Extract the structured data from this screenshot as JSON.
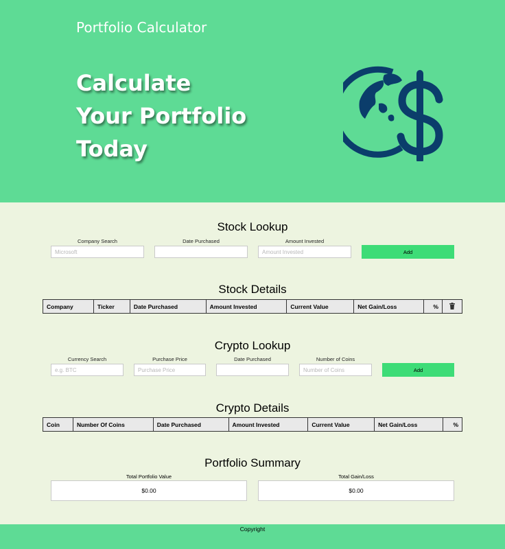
{
  "header": {
    "brand": "Portfolio Calculator",
    "headline": [
      "Calculate",
      "Your Portfolio",
      "Today"
    ],
    "logo_icon": "globe-dollar-icon",
    "logo_color": "#0b3d6b"
  },
  "stock_lookup": {
    "title": "Stock Lookup",
    "company_label": "Company Search",
    "company_placeholder": "Microsoft",
    "date_label": "Date Purchased",
    "amount_label": "Amount Invested",
    "amount_placeholder": "Amount Invested",
    "add_label": "Add"
  },
  "stock_details": {
    "title": "Stock Details",
    "columns": [
      "Company",
      "Ticker",
      "Date Purchased",
      "Amount Invested",
      "Current Value",
      "Net Gain/Loss",
      "%"
    ],
    "trash_icon": "trash-icon"
  },
  "crypto_lookup": {
    "title": "Crypto Lookup",
    "currency_label": "Currency Search",
    "currency_placeholder": "e.g. BTC",
    "price_label": "Purchase Price",
    "price_placeholder": "Purchase Price",
    "date_label": "Date Purchased",
    "coins_label": "Number of Coins",
    "coins_placeholder": "Number of Coins",
    "add_label": "Add"
  },
  "crypto_details": {
    "title": "Crypto Details",
    "columns": [
      "Coin",
      "Number Of Coins",
      "Date Purchased",
      "Amount Invested",
      "Current Value",
      "Net Gain/Loss",
      "%"
    ]
  },
  "summary": {
    "title": "Portfolio Summary",
    "total_value_label": "Total Portfolio Value",
    "total_value": "$0.00",
    "total_gain_label": "Total Gain/Loss",
    "total_gain": "$0.00"
  },
  "footer": {
    "text": "Copyright"
  },
  "colors": {
    "hero": "#5edb95",
    "body": "#edf4e0",
    "button": "#3ddc77",
    "navy": "#0b3d6b"
  }
}
